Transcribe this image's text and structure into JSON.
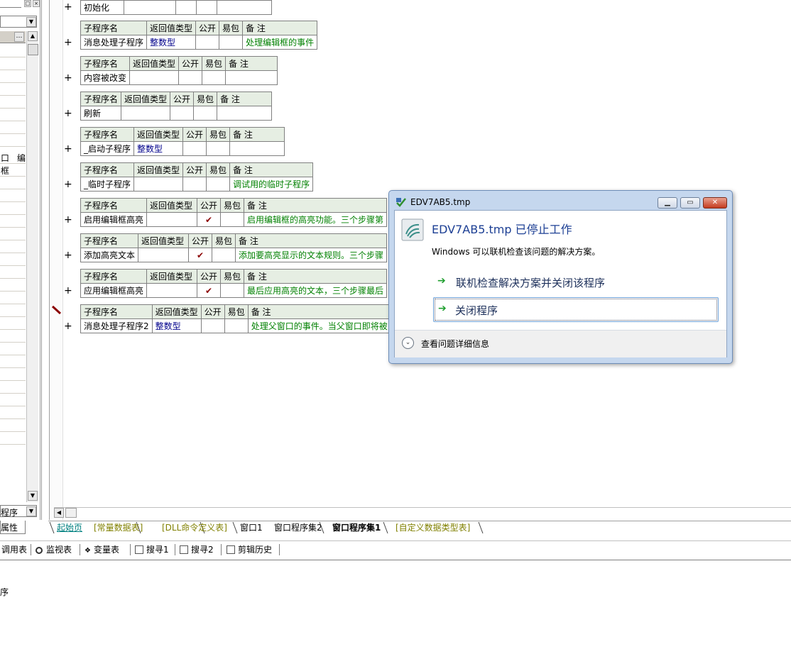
{
  "left_panel": {
    "frag1": "口",
    "frag2": "编",
    "frag3": "框",
    "combo_text": "程序",
    "tab_label": "属性"
  },
  "subs": [
    {
      "name": "初始化",
      "ret": "",
      "pub": "",
      "easy": "",
      "note": ""
    },
    {
      "name": "消息处理子程序",
      "ret": "整数型",
      "pub": "",
      "easy": "",
      "note": "处理编辑框的事件"
    },
    {
      "name": "内容被改变",
      "ret": "",
      "pub": "",
      "easy": "",
      "note": ""
    },
    {
      "name": "刷新",
      "ret": "",
      "pub": "",
      "easy": "",
      "note": ""
    },
    {
      "name": "_启动子程序",
      "ret": "整数型",
      "pub": "",
      "easy": "",
      "note": ""
    },
    {
      "name": "_临时子程序",
      "ret": "",
      "pub": "",
      "easy": "",
      "note": "调试用的临时子程序"
    },
    {
      "name": "启用编辑框高亮",
      "ret": "",
      "pub": "✔",
      "easy": "",
      "note": "启用编辑框的高亮功能。三个步骤第"
    },
    {
      "name": "添加高亮文本",
      "ret": "",
      "pub": "✔",
      "easy": "",
      "note": "添加要高亮显示的文本规则。三个步骤"
    },
    {
      "name": "应用编辑框高亮",
      "ret": "",
      "pub": "✔",
      "easy": "",
      "note": "最后应用高亮的文本，三个步骤最后"
    },
    {
      "name": "消息处理子程序2",
      "ret": "整数型",
      "pub": "",
      "easy": "",
      "note": "处理父窗口的事件。当父窗口即将被"
    }
  ],
  "headers": {
    "name": "子程序名",
    "ret": "返回值类型",
    "pub": "公开",
    "easy": "易包",
    "note": "备 注"
  },
  "plus_sign": "+",
  "tabs": [
    "起始页",
    "[常量数据表]",
    "[DLL命令定义表]",
    "窗口1",
    "窗口程序集2",
    "窗口程序集1",
    "[自定义数据类型表]"
  ],
  "toolbar": [
    "调用表",
    "监视表",
    "变量表",
    "搜寻1",
    "搜寻2",
    "剪辑历史"
  ],
  "bottom_text": "序",
  "dialog": {
    "title": "EDV7AB5.tmp",
    "heading": "EDV7AB5.tmp 已停止工作",
    "message": "Windows 可以联机检查该问题的解决方案。",
    "option1": "联机检查解决方案并关闭该程序",
    "option2": "关闭程序",
    "details": "查看问题详细信息"
  },
  "colors": {
    "header_bg": "#e6eee3",
    "type_text": "#00008b",
    "note_text": "#008000",
    "check": "#8b0000",
    "dialog_heading": "#1c3f94",
    "arrow": "#1f9f2f"
  }
}
